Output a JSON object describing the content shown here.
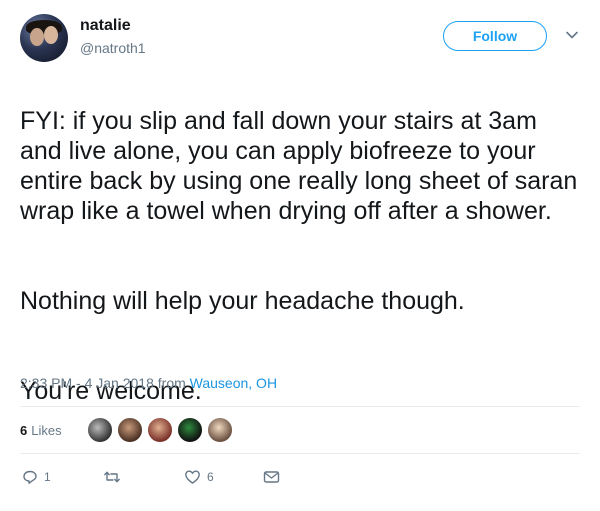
{
  "author": {
    "display_name": "natalie",
    "handle": "@natroth1"
  },
  "follow_label": "Follow",
  "tweet": {
    "lines": [
      "FYI: if you slip and fall down your stairs at 3am and live alone, you can apply biofreeze to your entire back by using one really long sheet of saran wrap like a towel when drying off after a shower.",
      "Nothing will help your headache though.",
      "You're welcome."
    ]
  },
  "meta": {
    "timestamp": "2:33 PM - 4 Jan 2018",
    "from_label": "from",
    "location": "Wauseon, OH"
  },
  "stats": {
    "likes_count": "6",
    "likes_label": "Likes"
  },
  "actions": {
    "reply_count": "1",
    "retweet_count": "",
    "like_count": "6"
  },
  "colors": {
    "accent": "#1da1f2",
    "link": "#1b95e0",
    "muted": "#657786",
    "divider": "#e6ecf0"
  }
}
